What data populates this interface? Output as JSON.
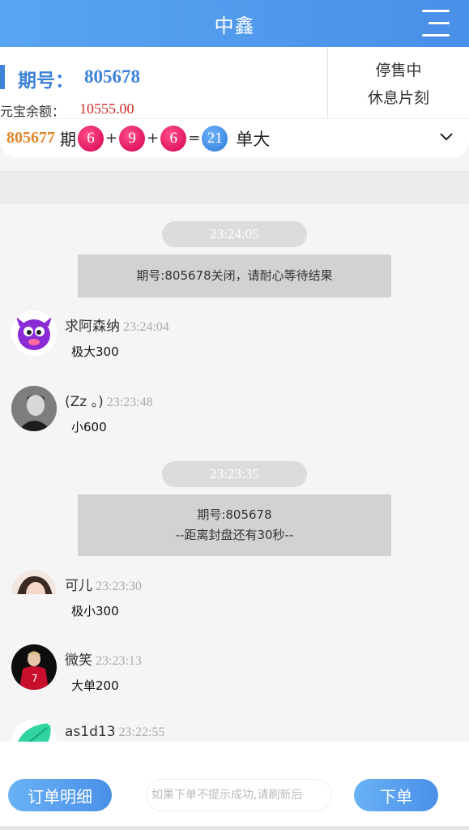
{
  "header": {
    "title": "中鑫"
  },
  "info": {
    "issue_label": "期号：",
    "issue_value": "805678",
    "balance_label": "元宝余额：",
    "balance_value": "10555.00",
    "status_line1": "停售中",
    "status_line2": "休息片刻"
  },
  "last_result": {
    "issue": "805677",
    "issue_suffix": "期",
    "balls": [
      "6",
      "9",
      "6"
    ],
    "plus": "+",
    "equals": "=",
    "sum": "21",
    "result_text": "单大"
  },
  "chat": {
    "messages": [
      {
        "type": "time",
        "text": "23:24:05"
      },
      {
        "type": "system",
        "lines": [
          "期号:805678关闭，请耐心等待结果"
        ]
      },
      {
        "type": "user",
        "name": "求阿森纳",
        "time": "23:24:04",
        "text": "极大300",
        "avatar": "purple-monster-avatar"
      },
      {
        "type": "user",
        "name": "(Zz 。)",
        "time": "23:23:48",
        "text": "小600",
        "avatar": "bw-portrait-avatar"
      },
      {
        "type": "time",
        "text": "23:23:35"
      },
      {
        "type": "system",
        "lines": [
          "期号:805678",
          "--距离封盘还有30秒--"
        ]
      },
      {
        "type": "user",
        "name": "可儿",
        "time": "23:23:30",
        "text": "极小300",
        "avatar": "girl-portrait-avatar"
      },
      {
        "type": "user",
        "name": "微笑",
        "time": "23:23:13",
        "text": "大单200",
        "avatar": "football-player-avatar"
      },
      {
        "type": "user",
        "name": "as1d13",
        "time": "23:22:55",
        "text": "",
        "avatar": "green-leaf-avatar"
      }
    ]
  },
  "footer": {
    "orders_label": "订单明细",
    "notice_placeholder": "如果下单不提示成功,请刷新后",
    "order_label": "下单"
  },
  "colors": {
    "accent": "#4a8fe8",
    "ball_red": "#e0065a",
    "ball_blue": "#3f8ae0",
    "balance": "#d0302a",
    "last_issue": "#e0862a"
  }
}
